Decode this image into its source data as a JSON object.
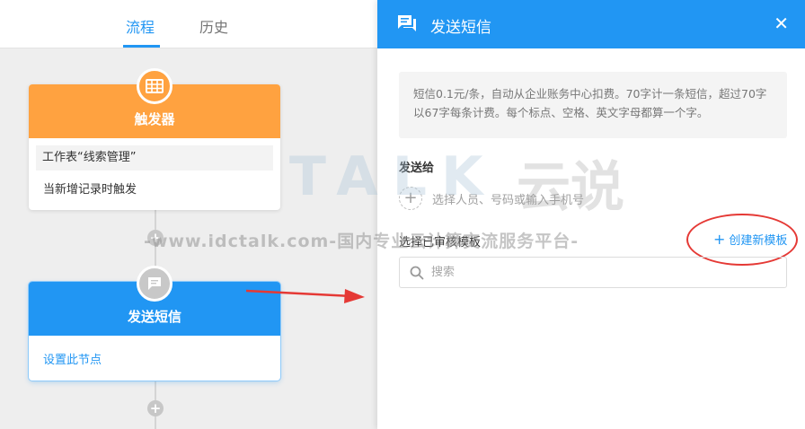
{
  "tabs": [
    {
      "label": "流程",
      "active": true
    },
    {
      "label": "历史",
      "active": false
    }
  ],
  "trigger_node": {
    "title": "触发器",
    "icon": "table-icon",
    "worksheet_text": "工作表“线索管理”",
    "condition_text": "当新增记录时触发"
  },
  "sms_node": {
    "title": "发送短信",
    "icon": "message-icon",
    "link": "设置此节点"
  },
  "panel": {
    "title": "发送短信",
    "close": "✕",
    "notice": "短信0.1元/条，自动从企业账务中心扣费。70字计一条短信，超过70字以67字每条计费。每个标点、空格、英文字母都算一个字。",
    "send_to_label": "发送给",
    "pick_placeholder": "选择人员、号码或输入手机号",
    "template_label": "选择已审核模板",
    "create_template": "创建新模板",
    "search_placeholder": "搜索"
  },
  "watermark": {
    "line": "-www.idctalk.com-国内专业云计算交流服务平台-",
    "big": "TALK",
    "cn": "云说"
  },
  "colors": {
    "primary": "#2196f3",
    "trigger": "#ffa240",
    "highlight_red": "#e53935"
  }
}
